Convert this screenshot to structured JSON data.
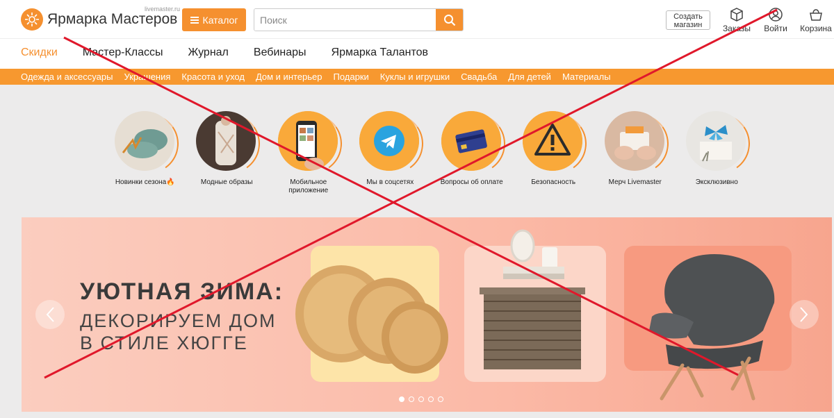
{
  "header": {
    "logo_text": "Ярмарка Мастеров",
    "logo_sub": "livemaster.ru",
    "catalog_label": "Каталог",
    "search_placeholder": "Поиск",
    "create_shop_label": "Создать магазин",
    "orders_label": "Заказы",
    "login_label": "Войти",
    "cart_label": "Корзина"
  },
  "topnav": [
    "Скидки",
    "Мастер-Классы",
    "Журнал",
    "Вебинары",
    "Ярмарка Талантов"
  ],
  "categories": [
    "Одежда и аксессуары",
    "Украшения",
    "Красота и уход",
    "Дом и интерьер",
    "Подарки",
    "Куклы и игрушки",
    "Свадьба",
    "Для детей",
    "Материалы"
  ],
  "stories": [
    {
      "label": "Новинки сезона🔥",
      "icon": "knit-hat-icon"
    },
    {
      "label": "Модные образы",
      "icon": "fashion-icon"
    },
    {
      "label": "Мобильное приложение",
      "icon": "phone-icon"
    },
    {
      "label": "Мы в соцсетях",
      "icon": "telegram-icon"
    },
    {
      "label": "Вопросы об оплате",
      "icon": "card-icon"
    },
    {
      "label": "Безопасность",
      "icon": "warning-icon"
    },
    {
      "label": "Мерч Livemaster",
      "icon": "merch-icon"
    },
    {
      "label": "Эксклюзивно",
      "icon": "butterfly-icon"
    }
  ],
  "banner": {
    "title": "УЮТНАЯ ЗИМА:",
    "subtitle_line1": "ДЕКОРИРУЕМ ДОМ",
    "subtitle_line2": "В СТИЛЕ ХЮГГЕ",
    "active_slide": 1,
    "slide_count": 5
  },
  "colors": {
    "accent": "#f5902f",
    "cross": "#e0182b"
  }
}
